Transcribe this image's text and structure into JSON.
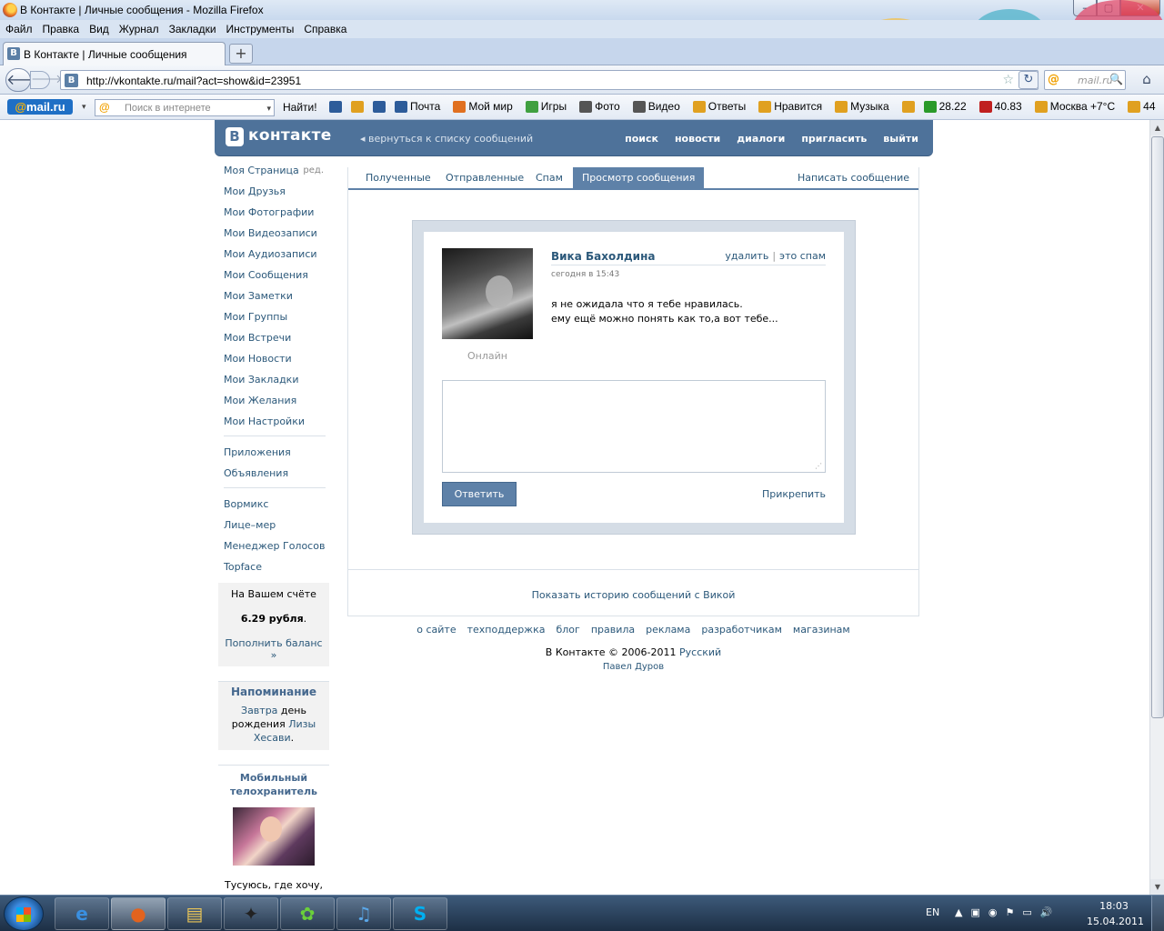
{
  "window": {
    "title": "В Контакте | Личные сообщения - Mozilla Firefox",
    "controls": {
      "minimize": "–",
      "maximize": "▢",
      "close": "✕"
    }
  },
  "menu": [
    "Файл",
    "Правка",
    "Вид",
    "Журнал",
    "Закладки",
    "Инструменты",
    "Справка"
  ],
  "tab": {
    "title": "В Контакте | Личные сообщения",
    "favicon": "B",
    "new_tab": "+"
  },
  "nav": {
    "back": "🡐",
    "forward": "🡒",
    "url": "http://vkontakte.ru/mail?act=show&id=23951",
    "star": "☆",
    "dropdown": "▾",
    "reload": "↻",
    "search_placeholder": "mail.ru",
    "search_glyph": "🔍",
    "home": "⌂"
  },
  "mailbar": {
    "logo_at": "@",
    "logo_rest": "mail.ru",
    "dropdown": "▾",
    "search_placeholder": "Поиск в интернете",
    "find": "Найти!",
    "items": [
      {
        "label": "",
        "icon": "font-size-icon",
        "color": "#2d5c9a"
      },
      {
        "label": "",
        "icon": "pencil-icon",
        "color": "#e0a020"
      },
      {
        "label": "",
        "icon": "zoom-icon",
        "color": "#2d5c9a"
      },
      {
        "label": "Почта",
        "icon": "mail-icon",
        "color": "#2d5c9a"
      },
      {
        "label": "Мой мир",
        "icon": "world-icon",
        "color": "#e07020"
      },
      {
        "label": "Игры",
        "icon": "games-icon",
        "color": "#40a040"
      },
      {
        "label": "Фото",
        "icon": "photo-icon",
        "color": "#555"
      },
      {
        "label": "Видео",
        "icon": "video-icon",
        "color": "#555"
      },
      {
        "label": "Ответы",
        "icon": "answers-icon",
        "color": "#e0a020"
      },
      {
        "label": "Нравится",
        "icon": "like-icon",
        "color": "#e0a020"
      },
      {
        "label": "Музыка",
        "icon": "music-icon",
        "color": "#e0a020"
      },
      {
        "label": "",
        "icon": "market-icon",
        "color": "#e0a020"
      },
      {
        "label": "28.22",
        "icon": "dollar-icon",
        "color": "#2a9a2a"
      },
      {
        "label": "40.83",
        "icon": "euro-icon",
        "color": "#c02020"
      },
      {
        "label": "Москва +7°C",
        "icon": "weather-icon",
        "color": "#e0a020"
      },
      {
        "label": "44",
        "icon": "traffic-icon",
        "color": "#e0a020"
      }
    ]
  },
  "vk": {
    "logo_b": "B",
    "logo_text": "контакте",
    "back_link": "вернуться к списку сообщений",
    "nav": [
      "поиск",
      "новости",
      "диалоги",
      "пригласить",
      "выйти"
    ],
    "sidebar": {
      "main": [
        "Моя Страница",
        "Мои Друзья",
        "Мои Фотографии",
        "Мои Видеозаписи",
        "Мои Аудиозаписи",
        "Мои Сообщения",
        "Мои Заметки",
        "Мои Группы",
        "Мои Встречи",
        "Мои Новости",
        "Мои Закладки",
        "Мои Желания",
        "Мои Настройки"
      ],
      "edit": "ред.",
      "apps": [
        "Приложения",
        "Объявления"
      ],
      "extra": [
        "Вормикс",
        "Лице–мер",
        "Менеджер Голосов",
        "Topface"
      ],
      "balance_title": "На Вашем счёте",
      "balance_value": "6.29 рубля",
      "balance_dot": ".",
      "balance_link": "Пополнить баланс »",
      "reminder_title": "Напоминание",
      "reminder_when": "Завтра",
      "reminder_text1": " день",
      "reminder_text2": "рождения ",
      "reminder_name": "Лизы Хесави",
      "reminder_dot": ".",
      "ad_title": "Мобильный телохранитель",
      "ad_text": "Тусуюсь, где хочу, ни о чем не тревожась. Узнать больше"
    },
    "tabs": [
      "Полученные",
      "Отправленные",
      "Спам"
    ],
    "active_tab": "Просмотр сообщения",
    "write": "Написать сообщение",
    "message": {
      "sender": "Вика Бахолдина",
      "delete": "удалить",
      "separator": "|",
      "spam": "это спам",
      "date": "сегодня в 15:43",
      "line1": "я не ожидала что я тебе нравилась.",
      "line2": "ему ещё можно понять как то,а вот тебе...",
      "status": "Онлайн"
    },
    "reply_button": "Ответить",
    "attach": "Прикрепить",
    "history": "Показать историю сообщений с Викой",
    "footer": {
      "links": [
        "о сайте",
        "техподдержка",
        "блог",
        "правила",
        "реклама",
        "разработчикам",
        "магазинам"
      ],
      "copyright": "В Контакте © 2006-2011",
      "language": "Русский",
      "author": "Павел Дуров"
    }
  },
  "taskbar": {
    "apps": [
      {
        "name": "ie-icon",
        "glyph": "e",
        "color": "#3a8fe0"
      },
      {
        "name": "firefox-icon",
        "glyph": "●",
        "color": "#e2631e"
      },
      {
        "name": "explorer-folder-icon",
        "glyph": "▤",
        "color": "#e8c458"
      },
      {
        "name": "scorpion-app-icon",
        "glyph": "✦",
        "color": "#222"
      },
      {
        "name": "icq-icon",
        "glyph": "✿",
        "color": "#6bd13a"
      },
      {
        "name": "itunes-icon",
        "glyph": "♫",
        "color": "#5aa7e8"
      },
      {
        "name": "skype-icon",
        "glyph": "S",
        "color": "#00aff0"
      }
    ],
    "lang": "EN",
    "tray_icons": [
      "▲",
      "▣",
      "◉",
      "⚑",
      "▭",
      "🔊"
    ],
    "time": "18:03",
    "date": "15.04.2011"
  }
}
